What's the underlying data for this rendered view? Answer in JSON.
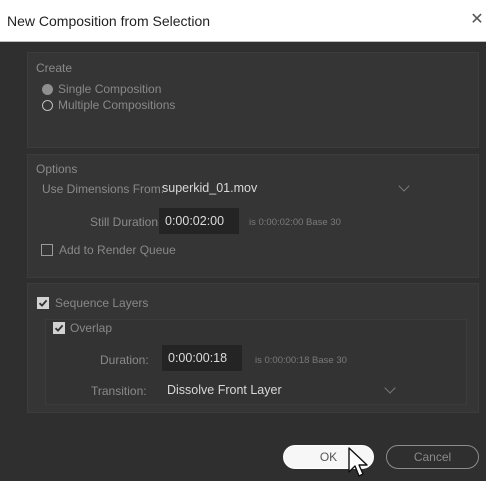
{
  "dialog": {
    "title": "New Composition from Selection",
    "close_glyph": "✕"
  },
  "create": {
    "header": "Create",
    "options": [
      {
        "label": "Single Composition",
        "selected": true
      },
      {
        "label": "Multiple Compositions",
        "selected": false
      }
    ]
  },
  "options": {
    "header": "Options",
    "use_dimensions_label": "Use Dimensions From:",
    "use_dimensions_value": "superkid_01.mov",
    "still_duration_label": "Still Duration:",
    "still_duration_value": "0:00:02:00",
    "still_duration_info": "is 0:00:02:00  Base 30",
    "add_to_render_queue_label": "Add to Render Queue",
    "add_to_render_queue_checked": false
  },
  "sequence": {
    "sequence_layers_label": "Sequence Layers",
    "sequence_layers_checked": true,
    "overlap_label": "Overlap",
    "overlap_checked": true,
    "duration_label": "Duration:",
    "duration_value": "0:00:00:18",
    "duration_info": "is 0:00:00:18  Base 30",
    "transition_label": "Transition:",
    "transition_value": "Dissolve Front Layer"
  },
  "buttons": {
    "ok_label": "OK",
    "cancel_label": "Cancel"
  },
  "icons": {
    "close": "close-icon",
    "chevron": "chevron-down-icon",
    "checkmark": "checkmark-icon",
    "cursor": "mouse-pointer-icon"
  }
}
